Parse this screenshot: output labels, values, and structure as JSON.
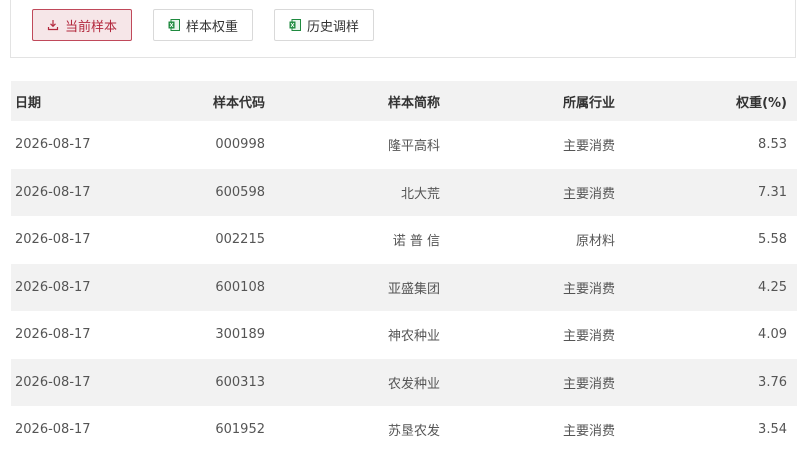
{
  "toolbar": {
    "buttons": [
      {
        "label": "当前样本",
        "icon": "download-icon",
        "active": true
      },
      {
        "label": "样本权重",
        "icon": "excel-icon",
        "active": false
      },
      {
        "label": "历史调样",
        "icon": "excel-icon",
        "active": false
      }
    ]
  },
  "table": {
    "headers": [
      "日期",
      "样本代码",
      "样本简称",
      "所属行业",
      "权重(%)"
    ],
    "rows": [
      {
        "date": "2026-08-17",
        "code": "000998",
        "name": "隆平高科",
        "industry": "主要消费",
        "weight": "8.53"
      },
      {
        "date": "2026-08-17",
        "code": "600598",
        "name": "北大荒",
        "industry": "主要消费",
        "weight": "7.31"
      },
      {
        "date": "2026-08-17",
        "code": "002215",
        "name": "诺 普 信",
        "industry": "原材料",
        "weight": "5.58"
      },
      {
        "date": "2026-08-17",
        "code": "600108",
        "name": "亚盛集团",
        "industry": "主要消费",
        "weight": "4.25"
      },
      {
        "date": "2026-08-17",
        "code": "300189",
        "name": "神农种业",
        "industry": "主要消费",
        "weight": "4.09"
      },
      {
        "date": "2026-08-17",
        "code": "600313",
        "name": "农发种业",
        "industry": "主要消费",
        "weight": "3.76"
      },
      {
        "date": "2026-08-17",
        "code": "601952",
        "name": "苏垦农发",
        "industry": "主要消费",
        "weight": "3.54"
      }
    ]
  },
  "colors": {
    "accent": "#b3283d",
    "accent_bg": "#f6e6e8",
    "header_bg": "#f2f2f2",
    "excel_green": "#1f8a3f"
  }
}
